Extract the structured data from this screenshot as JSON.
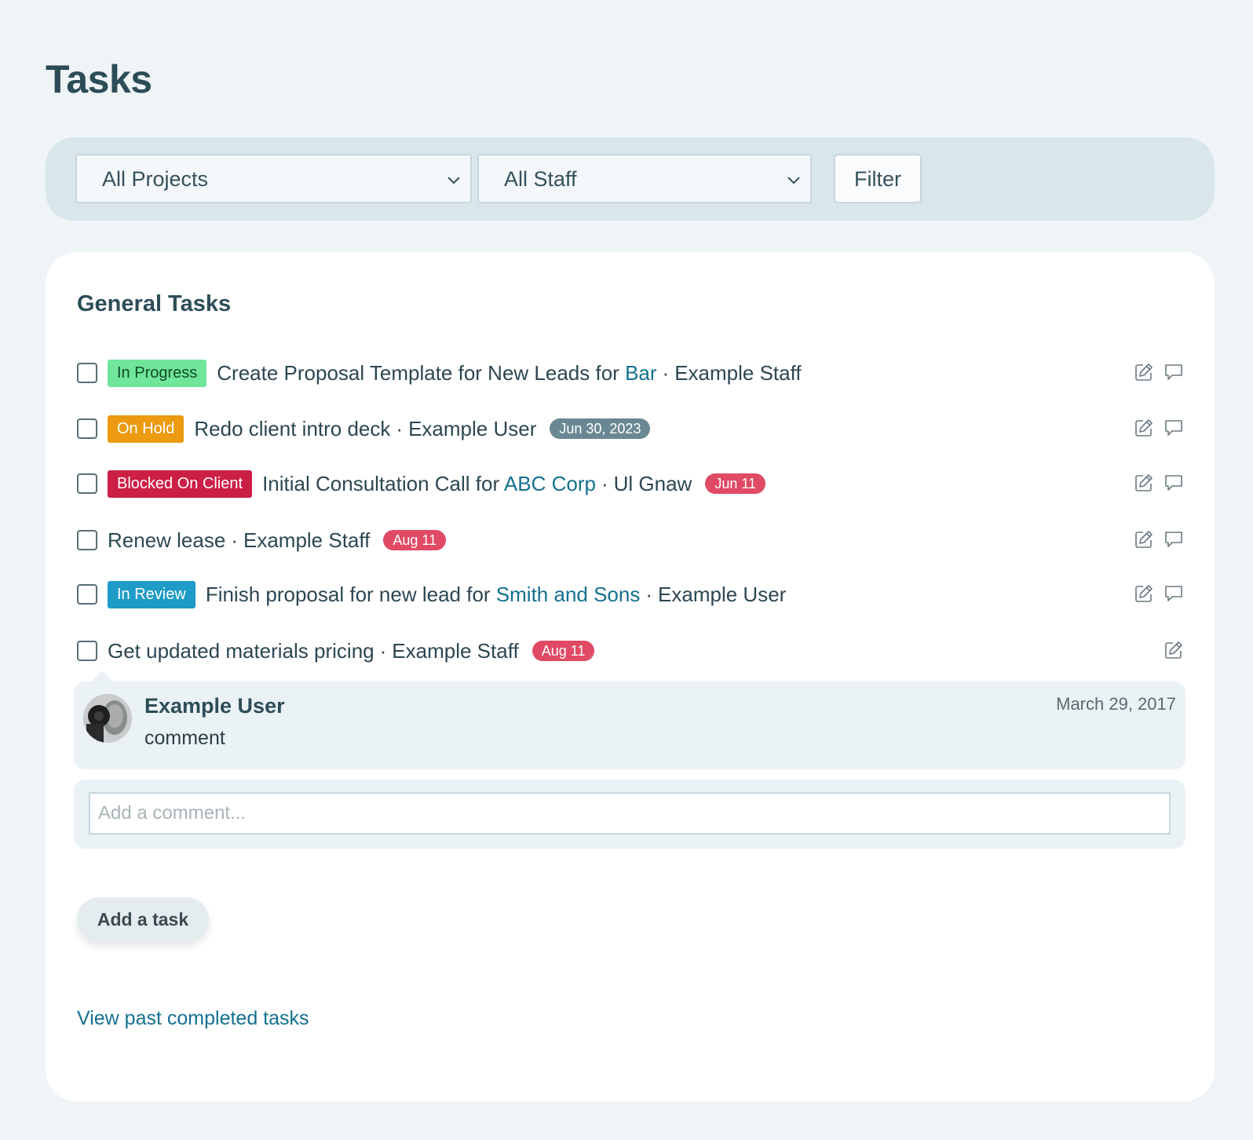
{
  "page": {
    "title": "Tasks"
  },
  "filters": {
    "project_select": "All Projects",
    "staff_select": "All Staff",
    "filter_button": "Filter"
  },
  "section": {
    "title": "General Tasks"
  },
  "tasks": [
    {
      "status": "In Progress",
      "status_color": "#6fe69a",
      "title": "Create Proposal Template for New Leads for",
      "client": "Bar",
      "assignee": "Example Staff",
      "date": "",
      "has_comment_icon": true
    },
    {
      "status": "On Hold",
      "status_color": "#ec9a10",
      "title": "Redo client intro deck",
      "client": "",
      "assignee": "Example User",
      "date": "Jun 30, 2023",
      "date_color": "#6a8894",
      "has_comment_icon": true
    },
    {
      "status": "Blocked On Client",
      "status_color": "#cc1f45",
      "title": "Initial Consultation Call for",
      "client": "ABC Corp",
      "assignee": "Ul Gnaw",
      "date": "Jun 11",
      "date_color": "#e04a64",
      "has_comment_icon": true
    },
    {
      "status": "",
      "title": "Renew lease",
      "client": "",
      "assignee": "Example Staff",
      "date": "Aug 11",
      "date_color": "#e04a64",
      "has_comment_icon": true
    },
    {
      "status": "In Review",
      "status_color": "#1e9bc6",
      "title": "Finish proposal for new lead for",
      "client": "Smith and Sons",
      "assignee": "Example User",
      "date": "",
      "has_comment_icon": true
    },
    {
      "status": "",
      "title": "Get updated materials pricing",
      "client": "",
      "assignee": "Example Staff",
      "date": "Aug 11",
      "date_color": "#e04a64",
      "has_comment_icon": false
    }
  ],
  "comment": {
    "author": "Example User",
    "body": "comment",
    "date": "March 29, 2017"
  },
  "add_comment": {
    "placeholder": "Add a comment..."
  },
  "add_task_button": "Add a task",
  "past_link": "View past completed tasks",
  "separator": "·"
}
